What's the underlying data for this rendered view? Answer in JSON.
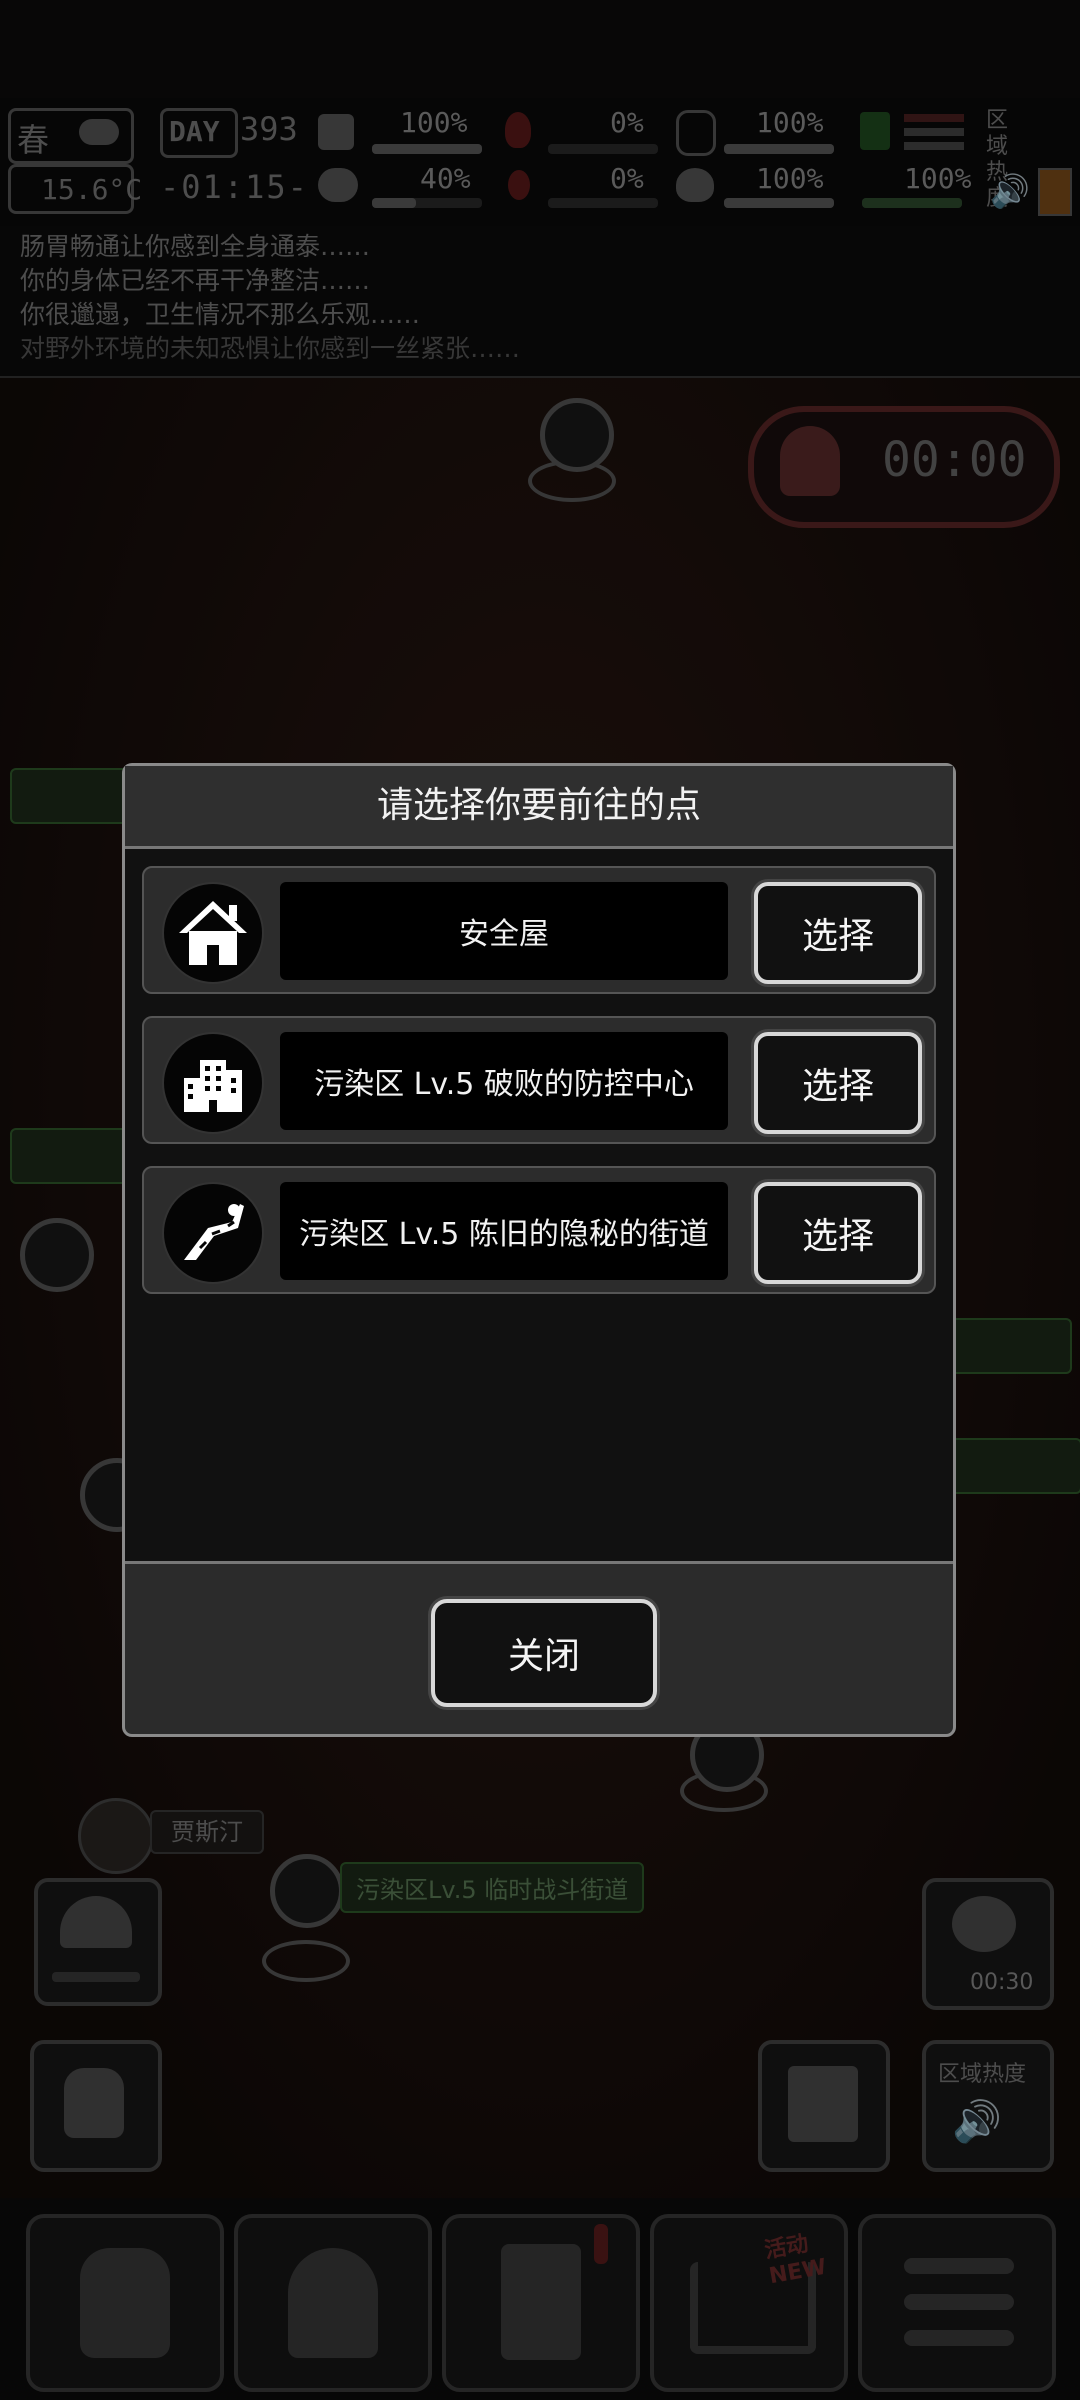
{
  "hud": {
    "season": "春",
    "temperature": "15.6°C",
    "day_label": "DAY",
    "day_number": "393",
    "time": "-01:15-",
    "stats": [
      {
        "name": "health",
        "value": "100%"
      },
      {
        "name": "brain",
        "value": "40%"
      },
      {
        "name": "bleed",
        "value": "0%"
      },
      {
        "name": "blood",
        "value": "0%"
      },
      {
        "name": "stomach",
        "value": "100%"
      },
      {
        "name": "heart",
        "value": "100%"
      },
      {
        "name": "thirst",
        "value": "100%"
      },
      {
        "name": "energy",
        "value": "100%"
      }
    ],
    "zone_heat_label": "区域热度"
  },
  "messages": [
    "肠胃畅通让你感到全身通泰……",
    "你的身体已经不再干净整洁……",
    "你很邋遢，卫生情况不那么乐观……",
    "对野外环境的未知恐惧让你感到一丝紧张……"
  ],
  "timer": "00:00",
  "map": {
    "labels": [
      {
        "text": "污染区Lv.5 临时战斗街道"
      },
      {
        "text": "贾斯汀"
      },
      {
        "text": "区域热度"
      },
      {
        "text": "00:30"
      }
    ]
  },
  "modal": {
    "title": "请选择你要前往的点",
    "destinations": [
      {
        "name": "安全屋",
        "icon": "house-icon",
        "button": "选择"
      },
      {
        "name": "污染区 Lv.5 破败的防控中心",
        "icon": "building-icon",
        "button": "选择"
      },
      {
        "name": "污染区 Lv.5 陈旧的隐秘的街道",
        "icon": "road-icon",
        "button": "选择"
      }
    ],
    "close_label": "关闭"
  },
  "bottom_nav": [
    {
      "icon": "backpack-icon"
    },
    {
      "icon": "brain-icon"
    },
    {
      "icon": "journal-icon"
    },
    {
      "icon": "shop-cart-icon",
      "badge": "活动 NEW"
    },
    {
      "icon": "menu-icon"
    }
  ]
}
